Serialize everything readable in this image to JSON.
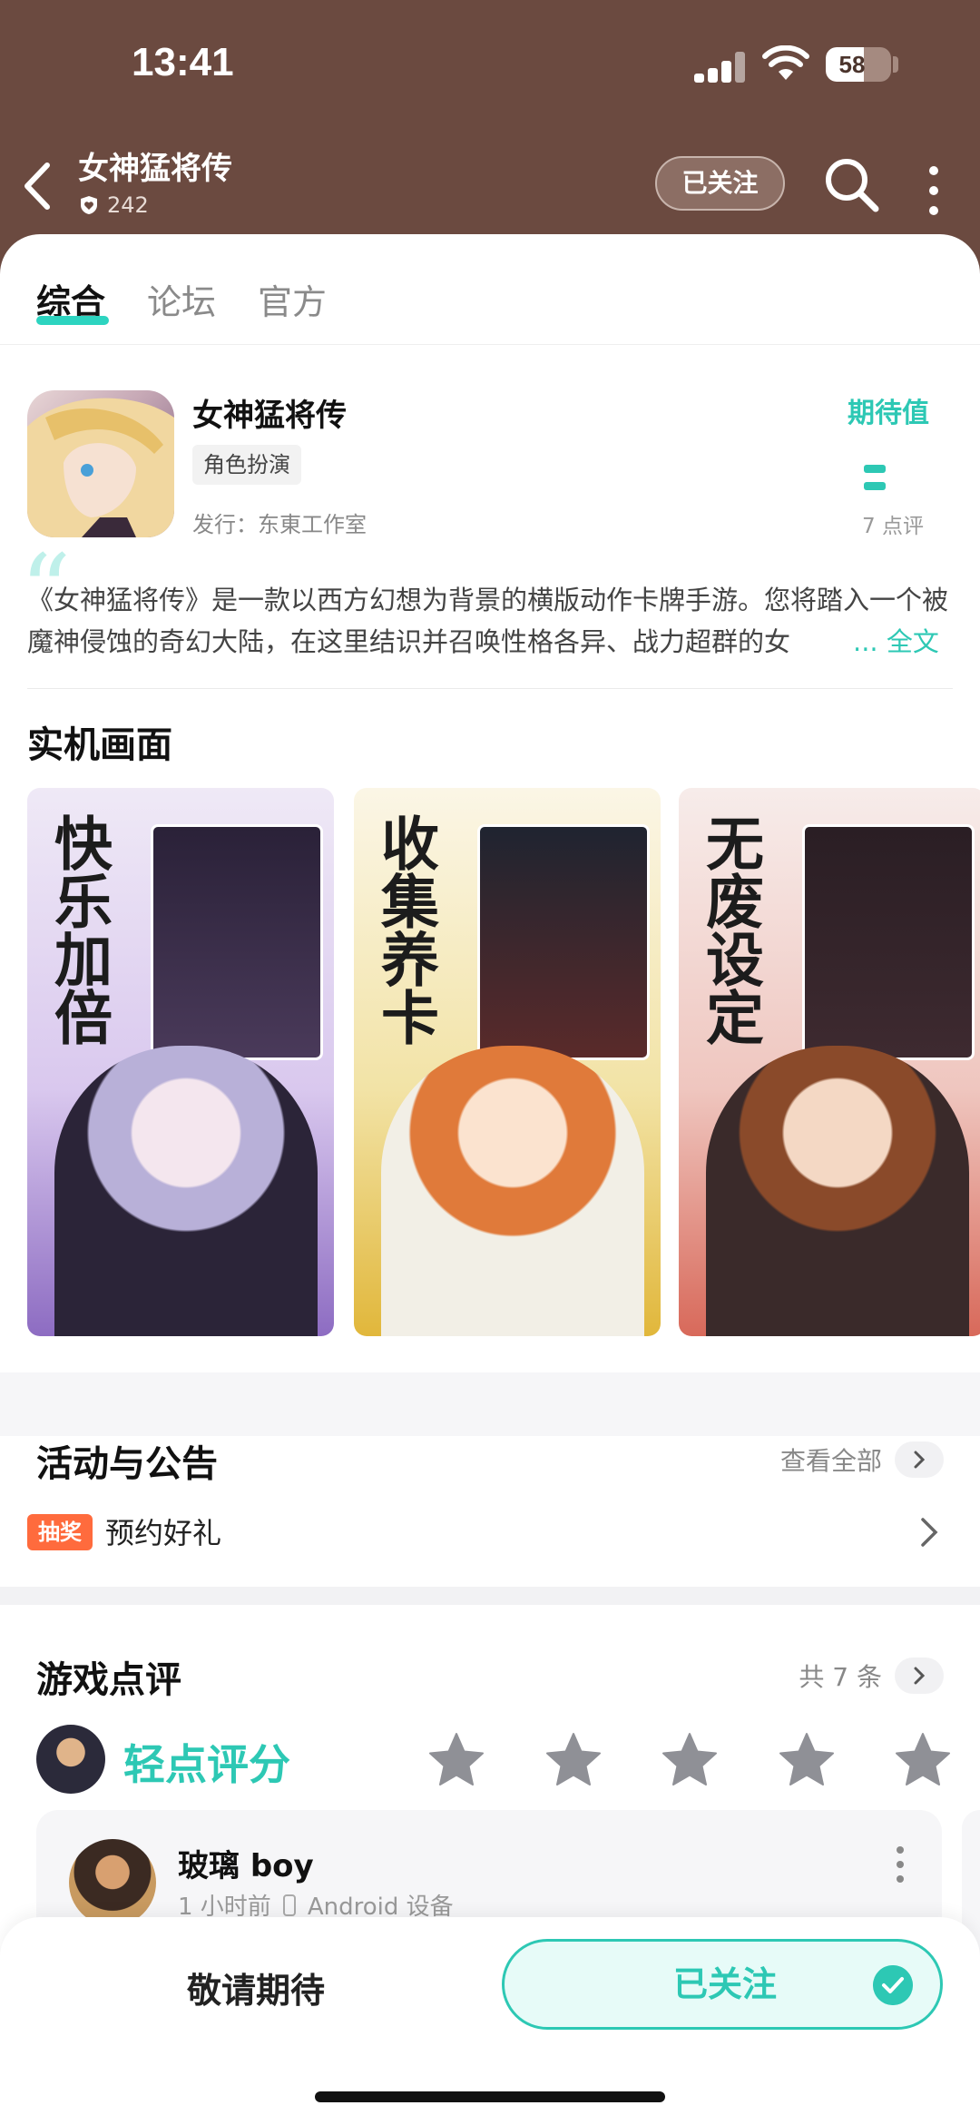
{
  "status_bar": {
    "time": "13:41",
    "battery": "58",
    "battery_level": 0.58
  },
  "header": {
    "title": "女神猛将传",
    "fans": "242",
    "follow_label": "已关注"
  },
  "tabs": [
    {
      "label": "综合",
      "active": true
    },
    {
      "label": "论坛",
      "active": false
    },
    {
      "label": "官方",
      "active": false
    }
  ],
  "game": {
    "name": "女神猛将传",
    "genre": "角色扮演",
    "publisher": "发行：东東工作室",
    "expect_label": "期待值",
    "expect_value": "--",
    "review_count": "7 点评",
    "description": "《女神猛将传》是一款以西方幻想为背景的横版动作卡牌手游。您将踏入一个被魔神侵蚀的奇幻大陆，在这里结识并召唤性格各异、战力超群的女",
    "more_label": "... 全文"
  },
  "screenshots": {
    "title": "实机画面",
    "items": [
      {
        "caption": "快乐加倍",
        "color": "#a78bd4"
      },
      {
        "caption": "收集养卡",
        "color": "#e9c74a"
      },
      {
        "caption": "无废设定",
        "color": "#e98070"
      }
    ]
  },
  "events": {
    "title": "活动与公告",
    "see_all": "查看全部",
    "items": [
      {
        "tag": "抽奖",
        "title": "预约好礼"
      }
    ]
  },
  "reviews": {
    "title": "游戏点评",
    "count": "共 7 条",
    "rate_label": "轻点评分",
    "stars": 5,
    "first": {
      "name": "玻璃 boy",
      "time": "1 小时前",
      "device": "Android 设备"
    }
  },
  "bottom_bar": {
    "coming_label": "敬请期待",
    "followed_label": "已关注"
  },
  "colors": {
    "accent": "#2dc8b4",
    "header_bg": "#6b4a40",
    "lottery_tag": "#ff6b3d"
  }
}
